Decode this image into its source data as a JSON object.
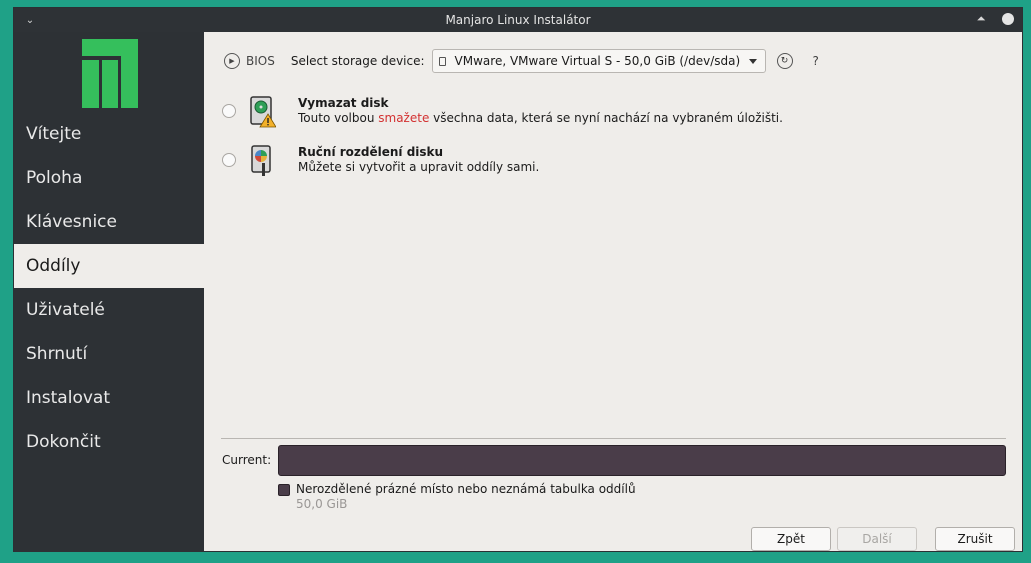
{
  "window": {
    "title": "Manjaro Linux Instalátor"
  },
  "sidebar": {
    "items": [
      {
        "label": "Vítejte"
      },
      {
        "label": "Poloha"
      },
      {
        "label": "Klávesnice"
      },
      {
        "label": "Oddíly",
        "active": true
      },
      {
        "label": "Uživatelé"
      },
      {
        "label": "Shrnutí"
      },
      {
        "label": "Instalovat"
      },
      {
        "label": "Dokončit"
      }
    ]
  },
  "topbar": {
    "bios_label": "BIOS",
    "select_label": "Select storage device:",
    "device_value": "VMware, VMware Virtual S - 50,0 GiB (/dev/sda)",
    "help_label": "?"
  },
  "options": {
    "erase": {
      "title": "Vymazat disk",
      "desc_before": "Touto volbou ",
      "desc_danger": "smažete",
      "desc_after": " všechna data, která se nyní nachází na vybraném úložišti.",
      "icon": "drive-harddisk-warning-icon"
    },
    "manual": {
      "title": "Ruční rozdělení disku",
      "desc": "Můžete si vytvořit a upravit oddíly sami.",
      "icon": "drive-harddisk-edit-icon"
    }
  },
  "current": {
    "label": "Current:",
    "legend_text": "Nerozdělené prázné místo nebo neznámá tabulka oddílů",
    "legend_size": "50,0 GiB",
    "bar_color": "#4a3d49"
  },
  "buttons": {
    "back": "Zpět",
    "next": "Další",
    "cancel": "Zrušit"
  },
  "colors": {
    "accent": "#35bf5c",
    "sidebar": "#2d3135",
    "desktop": "#1fa187"
  }
}
